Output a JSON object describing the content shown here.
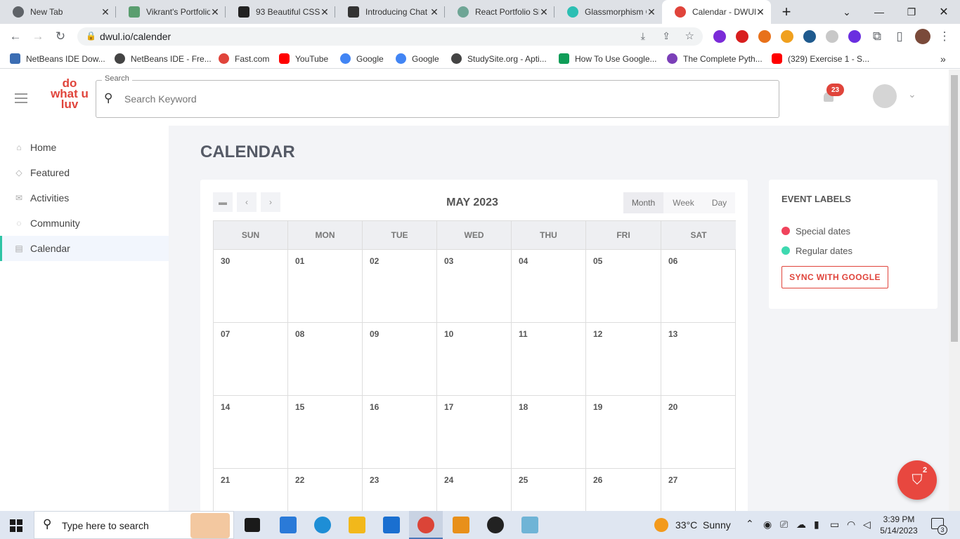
{
  "browser": {
    "tabs": [
      {
        "title": "New Tab",
        "favicon_color": "#5f6368"
      },
      {
        "title": "Vikrant's Portfolio",
        "favicon_color": "#5a9e6f"
      },
      {
        "title": "93 Beautiful CSS",
        "favicon_color": "#222222"
      },
      {
        "title": "Introducing Chat",
        "favicon_color": "#333333"
      },
      {
        "title": "React Portfolio Sl",
        "favicon_color": "#6ea595"
      },
      {
        "title": "Glassmorphism C",
        "favicon_color": "#2cbfb3"
      },
      {
        "title": "Calendar - DWUL",
        "favicon_color": "#e0443b",
        "active": true
      }
    ],
    "new_tab": "+",
    "url": "dwul.io/calender",
    "bookmarks": [
      {
        "label": "NetBeans IDE Dow...",
        "color": "#3b6db3"
      },
      {
        "label": "NetBeans IDE - Fre...",
        "color": "#444444"
      },
      {
        "label": "Fast.com",
        "color": "#e0443b"
      },
      {
        "label": "YouTube",
        "color": "#ff0000"
      },
      {
        "label": "Google",
        "color": "#4285f4"
      },
      {
        "label": "Google",
        "color": "#4285f4"
      },
      {
        "label": "StudySite.org - Apti...",
        "color": "#444444"
      },
      {
        "label": "How To Use Google...",
        "color": "#0f9d58"
      },
      {
        "label": "The Complete Pyth...",
        "color": "#7b3fb8"
      },
      {
        "label": "(329) Exercise 1 - S...",
        "color": "#ff0000"
      }
    ],
    "bookmarks_more": "»"
  },
  "app": {
    "logo": "do what u luv",
    "search_label": "Search",
    "search_placeholder": "Search Keyword",
    "notification_count": "23",
    "nav": [
      {
        "label": "Home",
        "icon": "home-icon"
      },
      {
        "label": "Featured",
        "icon": "tag-icon"
      },
      {
        "label": "Activities",
        "icon": "mail-icon"
      },
      {
        "label": "Community",
        "icon": "chat-icon"
      },
      {
        "label": "Calendar",
        "icon": "calendar-icon",
        "active": true
      }
    ],
    "page_title": "CALENDAR",
    "calendar": {
      "month_label": "MAY 2023",
      "views": [
        "Month",
        "Week",
        "Day"
      ],
      "selected_view": "Month",
      "weekdays": [
        "SUN",
        "MON",
        "TUE",
        "WED",
        "THU",
        "FRI",
        "SAT"
      ],
      "weeks": [
        [
          "30",
          "01",
          "02",
          "03",
          "04",
          "05",
          "06"
        ],
        [
          "07",
          "08",
          "09",
          "10",
          "11",
          "12",
          "13"
        ],
        [
          "14",
          "15",
          "16",
          "17",
          "18",
          "19",
          "20"
        ],
        [
          "21",
          "22",
          "23",
          "24",
          "25",
          "26",
          "27"
        ]
      ]
    },
    "event_labels": {
      "title": "EVENT LABELS",
      "items": [
        {
          "label": "Special dates",
          "color": "#f0435c"
        },
        {
          "label": "Regular dates",
          "color": "#3ed9b0"
        }
      ],
      "sync_button": "SYNC WITH GOOGLE"
    },
    "cart_count": "2"
  },
  "taskbar": {
    "search_placeholder": "Type here to search",
    "weather": "33°C  Sunny",
    "time": "3:39 PM",
    "date": "5/14/2023",
    "notification_count": "3"
  }
}
